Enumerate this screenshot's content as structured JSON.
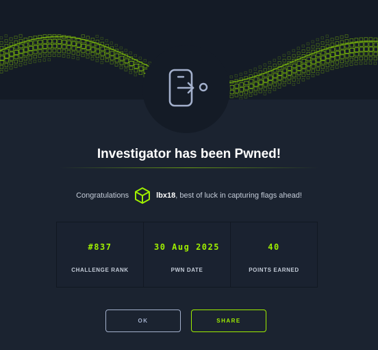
{
  "header": {
    "top_crumb": "",
    "top_value": "• ••••"
  },
  "dialog": {
    "title": "Investigator has been Pwned!",
    "congrats_prefix": "Congratulations",
    "username": "lbx18",
    "congrats_suffix": ", best of luck in capturing flags ahead!",
    "stats": [
      {
        "value": "#837",
        "label": "CHALLENGE RANK"
      },
      {
        "value": "30 Aug 2025",
        "label": "PWN DATE"
      },
      {
        "value": "40",
        "label": "POINTS EARNED"
      }
    ],
    "buttons": {
      "ok_label": "OK",
      "share_label": "SHARE"
    }
  },
  "icons": {
    "avatar": "phone-logout-icon",
    "user": "hexagon-cube-icon"
  },
  "colors": {
    "background": "#1b2330",
    "accent": "#9fef00",
    "text": "#ffffff",
    "muted": "#a4b1cd"
  }
}
